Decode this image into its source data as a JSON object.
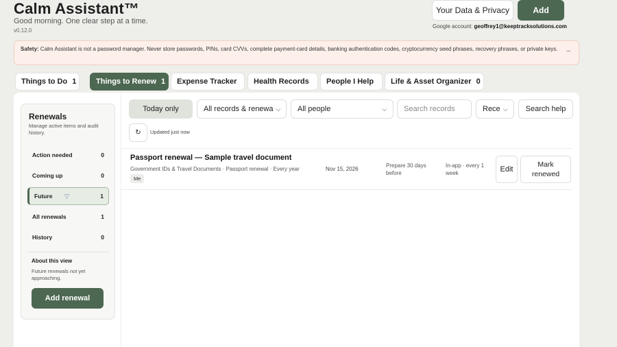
{
  "header": {
    "title": "Calm Assistant™",
    "greeting": "Good morning. One clear step at a time.",
    "version": "v0.12.0",
    "privacy_label": "Your Data & Privacy",
    "add_label": "Add",
    "account_label": "Google account:",
    "account_email": "geoffrey1@keeptracksolutions.com"
  },
  "safety": {
    "label": "Safety:",
    "text": "Calm Assistant is not a password manager. Never store passwords, PINs, card CVVs, complete payment-card details, banking authentication codes, cryptocurrency seed phrases, recovery phrases, or private keys.",
    "close": "–"
  },
  "tabs": [
    {
      "label": "Things to Do",
      "count": "1"
    },
    {
      "label": "Things to Renew",
      "count": "1"
    },
    {
      "label": "Expense Tracker",
      "count": ""
    },
    {
      "label": "Health Records",
      "count": ""
    },
    {
      "label": "People I Help",
      "count": ""
    },
    {
      "label": "Life & Asset Organizer",
      "count": "0"
    }
  ],
  "sidebar": {
    "title": "Renewals",
    "subtitle": "Manage active items and audit history.",
    "items": [
      {
        "label": "Action needed",
        "count": "0"
      },
      {
        "label": "Coming up",
        "count": "0"
      },
      {
        "label": "Future",
        "count": "1"
      },
      {
        "label": "All renewals",
        "count": "1"
      },
      {
        "label": "History",
        "count": "0"
      }
    ],
    "about_title": "About this view",
    "about_text": "Future renewals not yet approaching.",
    "add_label": "Add renewal"
  },
  "toolbar": {
    "today_label": "Today only",
    "records_select": "All records & renewa",
    "people_select": "All people",
    "search_placeholder": "Search records",
    "sort_select": "Rece",
    "help_label": "Search help",
    "refresh_glyph": "↻",
    "updated": "Updated just now"
  },
  "record": {
    "title": "Passport renewal — Sample travel document",
    "meta": "Government IDs & Travel Documents · Passport renewal · Every year",
    "tag": "Me",
    "date": "Nov 15, 2026",
    "prepare": "Prepare 30 days before",
    "reminder": "In-app · every 1 week",
    "edit_label": "Edit",
    "mark_label": "Mark renewed"
  },
  "colors": {
    "accent": "#4d6852",
    "safety_bg": "#fdf0ea",
    "page_bg": "#eeeeea"
  },
  "icons": [
    "refresh-icon",
    "chevron-down-icon",
    "close-icon",
    "cursor-icon"
  ]
}
